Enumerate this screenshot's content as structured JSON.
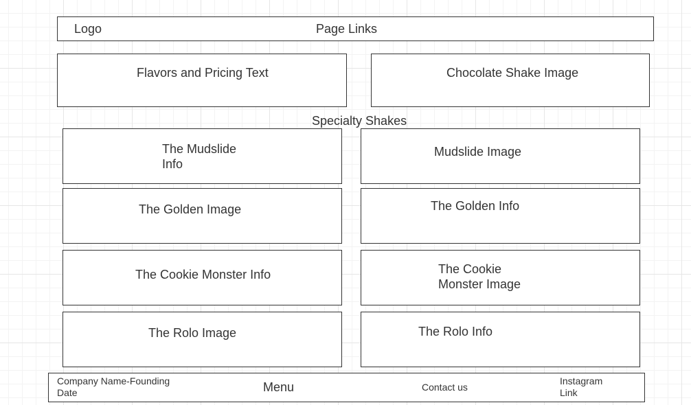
{
  "header": {
    "logo": "Logo",
    "page_links": "Page Links"
  },
  "hero": {
    "left": "Flavors and Pricing Text",
    "right": "Chocolate Shake Image"
  },
  "section_title": "Specialty Shakes",
  "shakes": {
    "mudslide_info_line1": "The Mudslide",
    "mudslide_info_line2": "Info",
    "mudslide_image": "Mudslide Image",
    "golden_image": "The Golden Image",
    "golden_info": "The Golden Info",
    "cookie_info": "The Cookie Monster Info",
    "cookie_image_line1": "The Cookie",
    "cookie_image_line2": "Monster Image",
    "rolo_image": "The Rolo Image",
    "rolo_info": "The Rolo Info"
  },
  "footer": {
    "company_line1": "Company Name-Founding",
    "company_line2": "Date",
    "menu": "Menu",
    "contact": "Contact us",
    "instagram_line1": "Instagram",
    "instagram_line2": "Link"
  }
}
